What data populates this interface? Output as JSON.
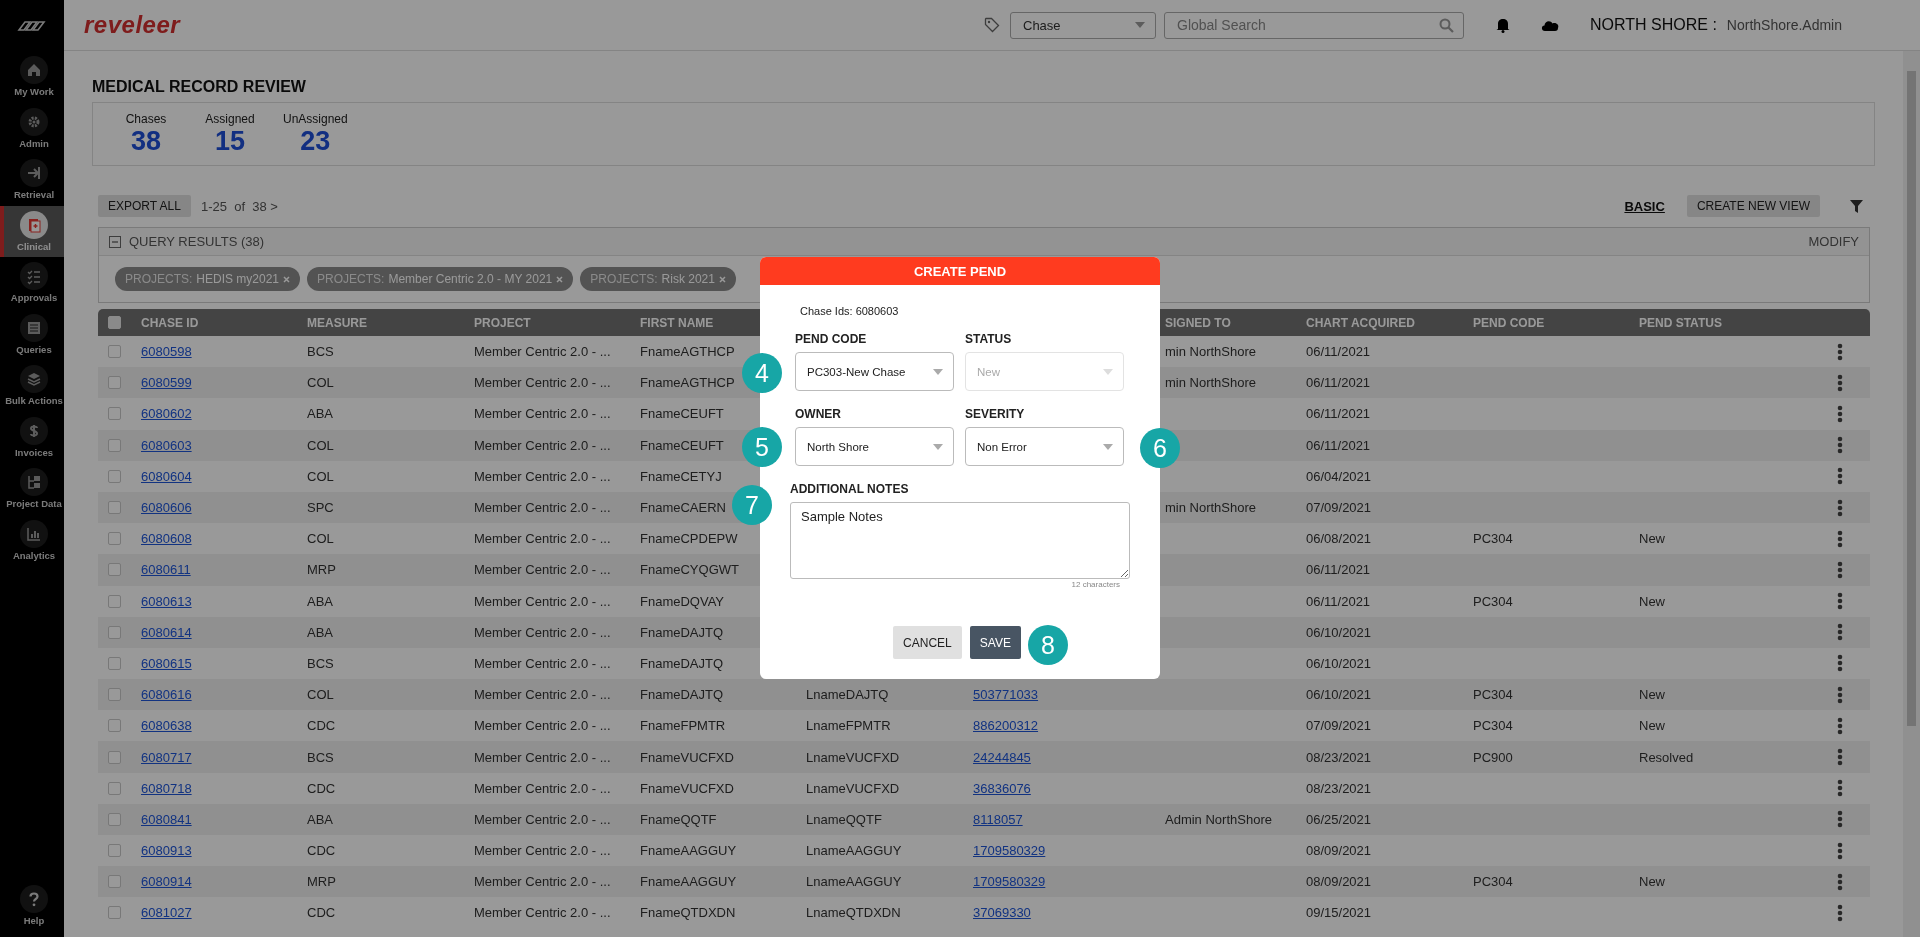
{
  "brand": "reveleer",
  "sidebar": {
    "items": [
      {
        "label": "My Work",
        "selected": false
      },
      {
        "label": "Admin",
        "selected": false
      },
      {
        "label": "Retrieval",
        "selected": false
      },
      {
        "label": "Clinical",
        "selected": true
      },
      {
        "label": "Approvals",
        "selected": false
      },
      {
        "label": "Queries",
        "selected": false
      },
      {
        "label": "Bulk Actions",
        "selected": false
      },
      {
        "label": "Invoices",
        "selected": false
      },
      {
        "label": "Project Data",
        "selected": false
      },
      {
        "label": "Analytics",
        "selected": false
      }
    ],
    "help": {
      "label": "Help"
    }
  },
  "topbar": {
    "type_select": "Chase",
    "search": {
      "placeholder": "Global Search"
    },
    "org": "NORTH SHORE :",
    "user": "NorthShore.Admin"
  },
  "page_title": "MEDICAL RECORD REVIEW",
  "stats": [
    {
      "label": "Chases",
      "value": "38"
    },
    {
      "label": "Assigned",
      "value": "15"
    },
    {
      "label": "UnAssigned",
      "value": "23"
    }
  ],
  "toolbar": {
    "export": "EXPORT ALL",
    "pagination": "1-25  of  38 >",
    "view": "BASIC",
    "create_view": "CREATE NEW VIEW"
  },
  "query": {
    "title": "QUERY RESULTS (38)",
    "modify": "MODIFY",
    "chips": [
      {
        "label": "PROJECTS:",
        "value": "HEDIS my2021"
      },
      {
        "label": "PROJECTS:",
        "value": "Member Centric 2.0 - MY 2021"
      },
      {
        "label": "PROJECTS:",
        "value": "Risk 2021"
      }
    ]
  },
  "table": {
    "select_all": {
      "checked": false
    },
    "columns": {
      "chase_id": "CHASE ID",
      "measure": "MEASURE",
      "project": "PROJECT",
      "first_name": "FIRST NAME",
      "assigned_to": "SIGNED TO",
      "chart_acquired": "CHART ACQUIRED",
      "pend_code": "PEND CODE",
      "pend_status": "PEND STATUS"
    },
    "rows": [
      {
        "checked": false,
        "chase_id": "6080598",
        "measure": "BCS",
        "project": "Member Centric 2.0 - ...",
        "first_name": "FnameAGTHCP",
        "assigned_to": "min NorthShore",
        "chart_acquired": "06/11/2021"
      },
      {
        "checked": false,
        "chase_id": "6080599",
        "measure": "COL",
        "project": "Member Centric 2.0 - ...",
        "first_name": "FnameAGTHCP",
        "assigned_to": "min NorthShore",
        "chart_acquired": "06/11/2021"
      },
      {
        "checked": false,
        "chase_id": "6080602",
        "measure": "ABA",
        "project": "Member Centric 2.0 - ...",
        "first_name": "FnameCEUFT",
        "chart_acquired": "06/11/2021"
      },
      {
        "checked": false,
        "chase_id": "6080603",
        "measure": "COL",
        "project": "Member Centric 2.0 - ...",
        "first_name": "FnameCEUFT",
        "chart_acquired": "06/11/2021"
      },
      {
        "checked": false,
        "chase_id": "6080604",
        "measure": "COL",
        "project": "Member Centric 2.0 - ...",
        "first_name": "FnameCETYJ",
        "chart_acquired": "06/04/2021"
      },
      {
        "checked": false,
        "chase_id": "6080606",
        "measure": "SPC",
        "project": "Member Centric 2.0 - ...",
        "first_name": "FnameCAERN",
        "assigned_to": "min NorthShore",
        "chart_acquired": "07/09/2021"
      },
      {
        "checked": false,
        "chase_id": "6080608",
        "measure": "COL",
        "project": "Member Centric 2.0 - ...",
        "first_name": "FnameCPDEPW",
        "chart_acquired": "06/08/2021",
        "pend_code": "PC304",
        "pend_status": "New"
      },
      {
        "checked": false,
        "chase_id": "6080611",
        "measure": "MRP",
        "project": "Member Centric 2.0 - ...",
        "first_name": "FnameCYQGWT",
        "chart_acquired": "06/11/2021"
      },
      {
        "checked": false,
        "chase_id": "6080613",
        "measure": "ABA",
        "project": "Member Centric 2.0 - ...",
        "first_name": "FnameDQVAY",
        "chart_acquired": "06/11/2021",
        "pend_code": "PC304",
        "pend_status": "New"
      },
      {
        "checked": false,
        "chase_id": "6080614",
        "measure": "ABA",
        "project": "Member Centric 2.0 - ...",
        "first_name": "FnameDAJTQ",
        "chart_acquired": "06/10/2021"
      },
      {
        "checked": false,
        "chase_id": "6080615",
        "measure": "BCS",
        "project": "Member Centric 2.0 - ...",
        "first_name": "FnameDAJTQ",
        "chart_acquired": "06/10/2021"
      },
      {
        "checked": false,
        "chase_id": "6080616",
        "measure": "COL",
        "project": "Member Centric 2.0 - ...",
        "first_name": "FnameDAJTQ",
        "last_name": "LnameDAJTQ",
        "column_6": "503771033",
        "chart_acquired": "06/10/2021",
        "pend_code": "PC304",
        "pend_status": "New"
      },
      {
        "checked": false,
        "chase_id": "6080638",
        "measure": "CDC",
        "project": "Member Centric 2.0 - ...",
        "first_name": "FnameFPMTR",
        "last_name": "LnameFPMTR",
        "column_6": "886200312",
        "chart_acquired": "07/09/2021",
        "pend_code": "PC304",
        "pend_status": "New"
      },
      {
        "checked": false,
        "chase_id": "6080717",
        "measure": "BCS",
        "project": "Member Centric 2.0 - ...",
        "first_name": "FnameVUCFXD",
        "last_name": "LnameVUCFXD",
        "column_6": "24244845",
        "chart_acquired": "08/23/2021",
        "pend_code": "PC900",
        "pend_status": "Resolved"
      },
      {
        "checked": false,
        "chase_id": "6080718",
        "measure": "CDC",
        "project": "Member Centric 2.0 - ...",
        "first_name": "FnameVUCFXD",
        "last_name": "LnameVUCFXD",
        "column_6": "36836076",
        "chart_acquired": "08/23/2021"
      },
      {
        "checked": false,
        "chase_id": "6080841",
        "measure": "ABA",
        "project": "Member Centric 2.0 - ...",
        "first_name": "FnameQQTF",
        "last_name": "LnameQQTF",
        "column_6": "8118057",
        "assigned_to": "Admin NorthShore",
        "chart_acquired": "06/25/2021"
      },
      {
        "checked": false,
        "chase_id": "6080913",
        "measure": "CDC",
        "project": "Member Centric 2.0 - ...",
        "first_name": "FnameAAGGUY",
        "last_name": "LnameAAGGUY",
        "column_6": "1709580329",
        "chart_acquired": "08/09/2021"
      },
      {
        "checked": false,
        "chase_id": "6080914",
        "measure": "MRP",
        "project": "Member Centric 2.0 - ...",
        "first_name": "FnameAAGGUY",
        "last_name": "LnameAAGGUY",
        "column_6": "1709580329",
        "chart_acquired": "08/09/2021",
        "pend_code": "PC304",
        "pend_status": "New"
      },
      {
        "checked": false,
        "chase_id": "6081027",
        "measure": "CDC",
        "project": "Member Centric 2.0 - ...",
        "first_name": "FnameQTDXDN",
        "last_name": "LnameQTDXDN",
        "column_6": "37069330",
        "chart_acquired": "09/15/2021"
      }
    ]
  },
  "dialog": {
    "title": "CREATE PEND",
    "chase_ids": "Chase Ids: 6080603",
    "fields": [
      {
        "label": "PEND CODE",
        "value": "PC303-New Chase",
        "disabled": false
      },
      {
        "label": "STATUS",
        "value": "New",
        "disabled": true
      },
      {
        "label": "OWNER",
        "value": "North Shore",
        "disabled": false
      },
      {
        "label": "SEVERITY",
        "value": "Non Error",
        "disabled": false
      }
    ],
    "notes": {
      "label": "ADDITIONAL NOTES",
      "value": "Sample Notes",
      "count": "12 characters"
    },
    "cancel": "CANCEL",
    "save": "SAVE"
  },
  "callouts": [
    "4",
    "5",
    "6",
    "7",
    "8"
  ]
}
